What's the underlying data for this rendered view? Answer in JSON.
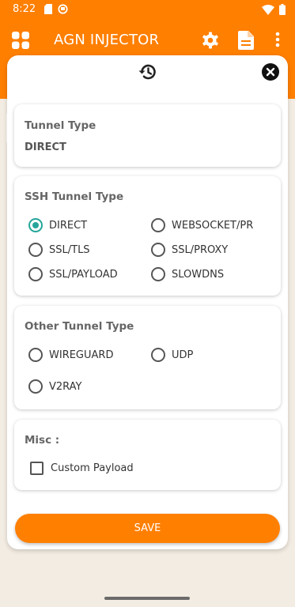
{
  "status_bar": {
    "time": "8:22"
  },
  "app_bar": {
    "title": "AGN INJECTOR"
  },
  "tunnel_type": {
    "title": "Tunnel Type",
    "value": "DIRECT"
  },
  "ssh_tunnel": {
    "title": "SSH Tunnel Type",
    "options": [
      {
        "label": "DIRECT",
        "selected": true
      },
      {
        "label": "WEBSOCKET/PR",
        "selected": false
      },
      {
        "label": "SSL/TLS",
        "selected": false
      },
      {
        "label": "SSL/PROXY",
        "selected": false
      },
      {
        "label": "SSL/PAYLOAD",
        "selected": false
      },
      {
        "label": "SLOWDNS",
        "selected": false
      }
    ]
  },
  "other_tunnel": {
    "title": "Other Tunnel Type",
    "options": [
      {
        "label": "WIREGUARD",
        "selected": false
      },
      {
        "label": "UDP",
        "selected": false
      },
      {
        "label": "V2RAY",
        "selected": false
      }
    ]
  },
  "misc": {
    "title": "Misc :",
    "custom_payload_label": "Custom Payload",
    "custom_payload_checked": false
  },
  "save_label": "SAVE",
  "colors": {
    "accent": "#ff7f00",
    "radio_selected": "#26a69a"
  },
  "icons": [
    "grid-icon",
    "gear-icon",
    "document-icon",
    "more-vert-icon",
    "history-icon",
    "close-icon",
    "wifi-icon",
    "battery-icon"
  ]
}
